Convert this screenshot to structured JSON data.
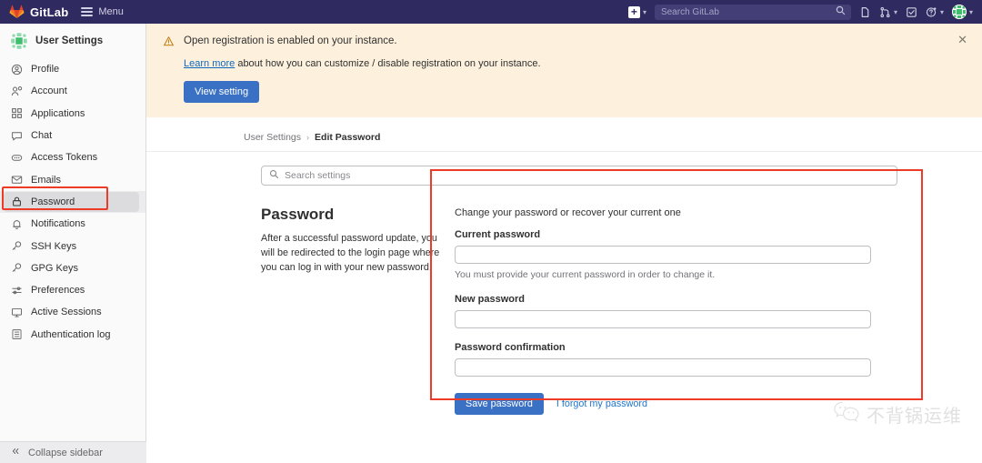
{
  "navbar": {
    "brand": "GitLab",
    "menu_label": "Menu",
    "brand_color": "#2f2a5f",
    "items": [
      {
        "name": "create-new",
        "icon": "plus-square-icon",
        "has_caret": true
      },
      {
        "name": "issues",
        "icon": "issues-icon",
        "has_caret": false
      },
      {
        "name": "merge-requests",
        "icon": "merge-request-icon",
        "has_caret": true
      },
      {
        "name": "todos",
        "icon": "todo-check-icon",
        "has_caret": false
      },
      {
        "name": "help",
        "icon": "question-circle-icon",
        "has_caret": true
      },
      {
        "name": "user-menu",
        "icon": "avatar-icon",
        "has_caret": true
      }
    ],
    "search": {
      "placeholder": "Search GitLab",
      "value": ""
    }
  },
  "sidebar": {
    "title": "User Settings",
    "active_item": "Password",
    "items": [
      {
        "label": "Profile",
        "icon": "user-circle-icon"
      },
      {
        "label": "Account",
        "icon": "account-gear-icon"
      },
      {
        "label": "Applications",
        "icon": "applications-grid-icon"
      },
      {
        "label": "Chat",
        "icon": "chat-bubble-icon"
      },
      {
        "label": "Access Tokens",
        "icon": "token-icon"
      },
      {
        "label": "Emails",
        "icon": "envelope-icon"
      },
      {
        "label": "Password",
        "icon": "lock-icon"
      },
      {
        "label": "Notifications",
        "icon": "bell-icon"
      },
      {
        "label": "SSH Keys",
        "icon": "key-icon"
      },
      {
        "label": "GPG Keys",
        "icon": "key-icon"
      },
      {
        "label": "Preferences",
        "icon": "sliders-icon"
      },
      {
        "label": "Active Sessions",
        "icon": "monitor-icon"
      },
      {
        "label": "Authentication log",
        "icon": "list-log-icon"
      }
    ],
    "collapse_label": "Collapse sidebar"
  },
  "alert": {
    "icon": "warning-triangle-icon",
    "title": "Open registration is enabled on your instance.",
    "link_text": "Learn more",
    "description_rest": " about how you can customize / disable registration on your instance.",
    "button_label": "View setting",
    "close_icon": "close-icon",
    "background": "#fdf1dd"
  },
  "breadcrumb": {
    "root": "User Settings",
    "separator": "›",
    "current": "Edit Password"
  },
  "settings_search": {
    "icon": "search-icon",
    "placeholder": "Search settings",
    "value": ""
  },
  "section": {
    "heading": "Password",
    "description": "After a successful password update, you will be redirected to the login page where you can log in with your new password.",
    "form": {
      "heading": "Change your password or recover your current one",
      "fields": [
        {
          "label": "Current password",
          "value": "",
          "help": "You must provide your current password in order to change it."
        },
        {
          "label": "New password",
          "value": "",
          "help": ""
        },
        {
          "label": "Password confirmation",
          "value": "",
          "help": ""
        }
      ],
      "submit_label": "Save password",
      "forgot_link": "I forgot my password"
    }
  },
  "highlights": {
    "color": "#ee3b27",
    "regions": [
      "sidebar-password-item",
      "password-form-panel"
    ]
  },
  "watermark": {
    "icon": "wechat-icon",
    "text": "不背锅运维"
  }
}
